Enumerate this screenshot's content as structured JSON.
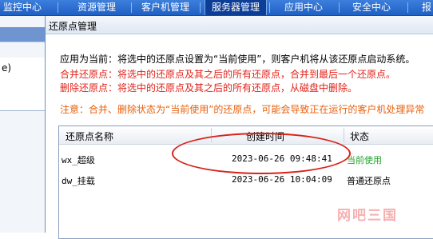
{
  "nav": {
    "items": [
      "监控中心",
      "资源管理",
      "客户机管理",
      "服务器管理",
      "应用中心",
      "安全中心",
      "报"
    ],
    "active": "服务器管理"
  },
  "left_fragment": "e)",
  "dialog": {
    "title": "还原点管理",
    "info": {
      "apply": "应用为当前：将选中的还原点设置为“当前使用”，则客户机将从该还原点启动系统。",
      "merge": "合并还原点：将选中的还原点及其之后的所有还原点，合并到最后一个还原点。",
      "delete": "删除还原点：将选中的还原点及其之后的所有还原点，从磁盘中删除。",
      "note": "注意：合并、删除状态为“当前使用”的还原点，可能会导致正在运行的客户机处理异常"
    },
    "list": {
      "columns": [
        "还原点名称",
        "创建时间",
        "状态"
      ],
      "rows": [
        {
          "name": "wx_超级",
          "created": "2023-06-26 09:48:41",
          "status": "当前使用"
        },
        {
          "name": "dw_挂载",
          "created": "2023-06-26 10:04:09",
          "status": "普通还原点"
        }
      ]
    }
  },
  "watermark": "网吧三国",
  "colors": {
    "nav_bg": "#2a6dd2",
    "nav_active": "#0d3e97",
    "red_text": "#e0231a",
    "orange_text": "#e8600c",
    "status_current": "#1fa52a",
    "annotation_circle": "#d8221a"
  }
}
